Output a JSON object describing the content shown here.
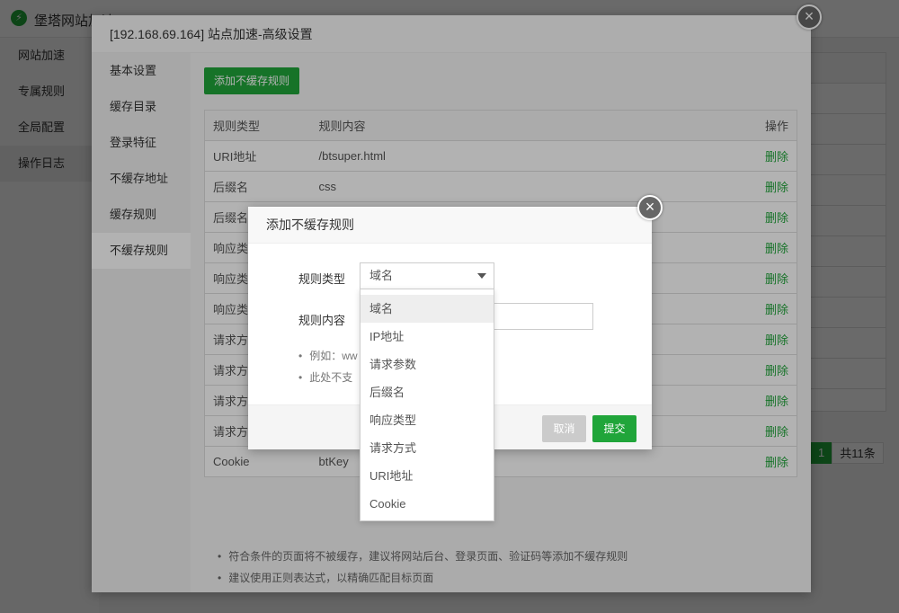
{
  "background": {
    "app_title": "堡塔网站加速",
    "logo_glyph": "⚡",
    "sidebar": [
      "网站加速",
      "专属规则",
      "全局配置",
      "操作日志"
    ],
    "pager": {
      "current": "1",
      "total": "共11条"
    }
  },
  "main_modal": {
    "title": "[192.168.69.164] 站点加速-高级设置",
    "close": "×",
    "sidebar": [
      "基本设置",
      "缓存目录",
      "登录特征",
      "不缓存地址",
      "缓存规则",
      "不缓存规则"
    ],
    "active_sidebar_index": 5,
    "add_button": "添加不缓存规则",
    "table": {
      "headers": [
        "规则类型",
        "规则内容",
        "操作"
      ],
      "rows": [
        {
          "type": "URI地址",
          "content": "/btsuper.html",
          "action": "删除"
        },
        {
          "type": "后缀名",
          "content": "css",
          "action": "删除"
        },
        {
          "type": "后缀名",
          "content": "",
          "action": "删除"
        },
        {
          "type": "响应类型",
          "content": "",
          "action": "删除"
        },
        {
          "type": "响应类型",
          "content": "",
          "action": "删除"
        },
        {
          "type": "响应类型",
          "content": "",
          "action": "删除"
        },
        {
          "type": "请求方式",
          "content": "",
          "action": "删除"
        },
        {
          "type": "请求方式",
          "content": "",
          "action": "删除"
        },
        {
          "type": "请求方式",
          "content": "",
          "action": "删除"
        },
        {
          "type": "请求方式",
          "content": "",
          "action": "删除"
        },
        {
          "type": "Cookie",
          "content": "btKey",
          "action": "删除"
        }
      ]
    },
    "tips": [
      "符合条件的页面将不被缓存，建议将网站后台、登录页面、验证码等添加不缓存规则",
      "建议使用正则表达式，以精确匹配目标页面"
    ]
  },
  "add_dialog": {
    "title": "添加不缓存规则",
    "close": "×",
    "rule_type_label": "规则类型",
    "rule_type_value": "域名",
    "rule_content_label": "规则内容",
    "rule_content_value": "",
    "hints": [
      "例如：ww",
      "此处不支"
    ],
    "cancel": "取消",
    "submit": "提交"
  },
  "dropdown": {
    "options": [
      "域名",
      "IP地址",
      "请求参数",
      "后缀名",
      "响应类型",
      "请求方式",
      "URI地址",
      "Cookie"
    ],
    "selected_index": 0
  },
  "colors": {
    "accent": "#20a53a",
    "cancel": "#cbcbcb"
  }
}
